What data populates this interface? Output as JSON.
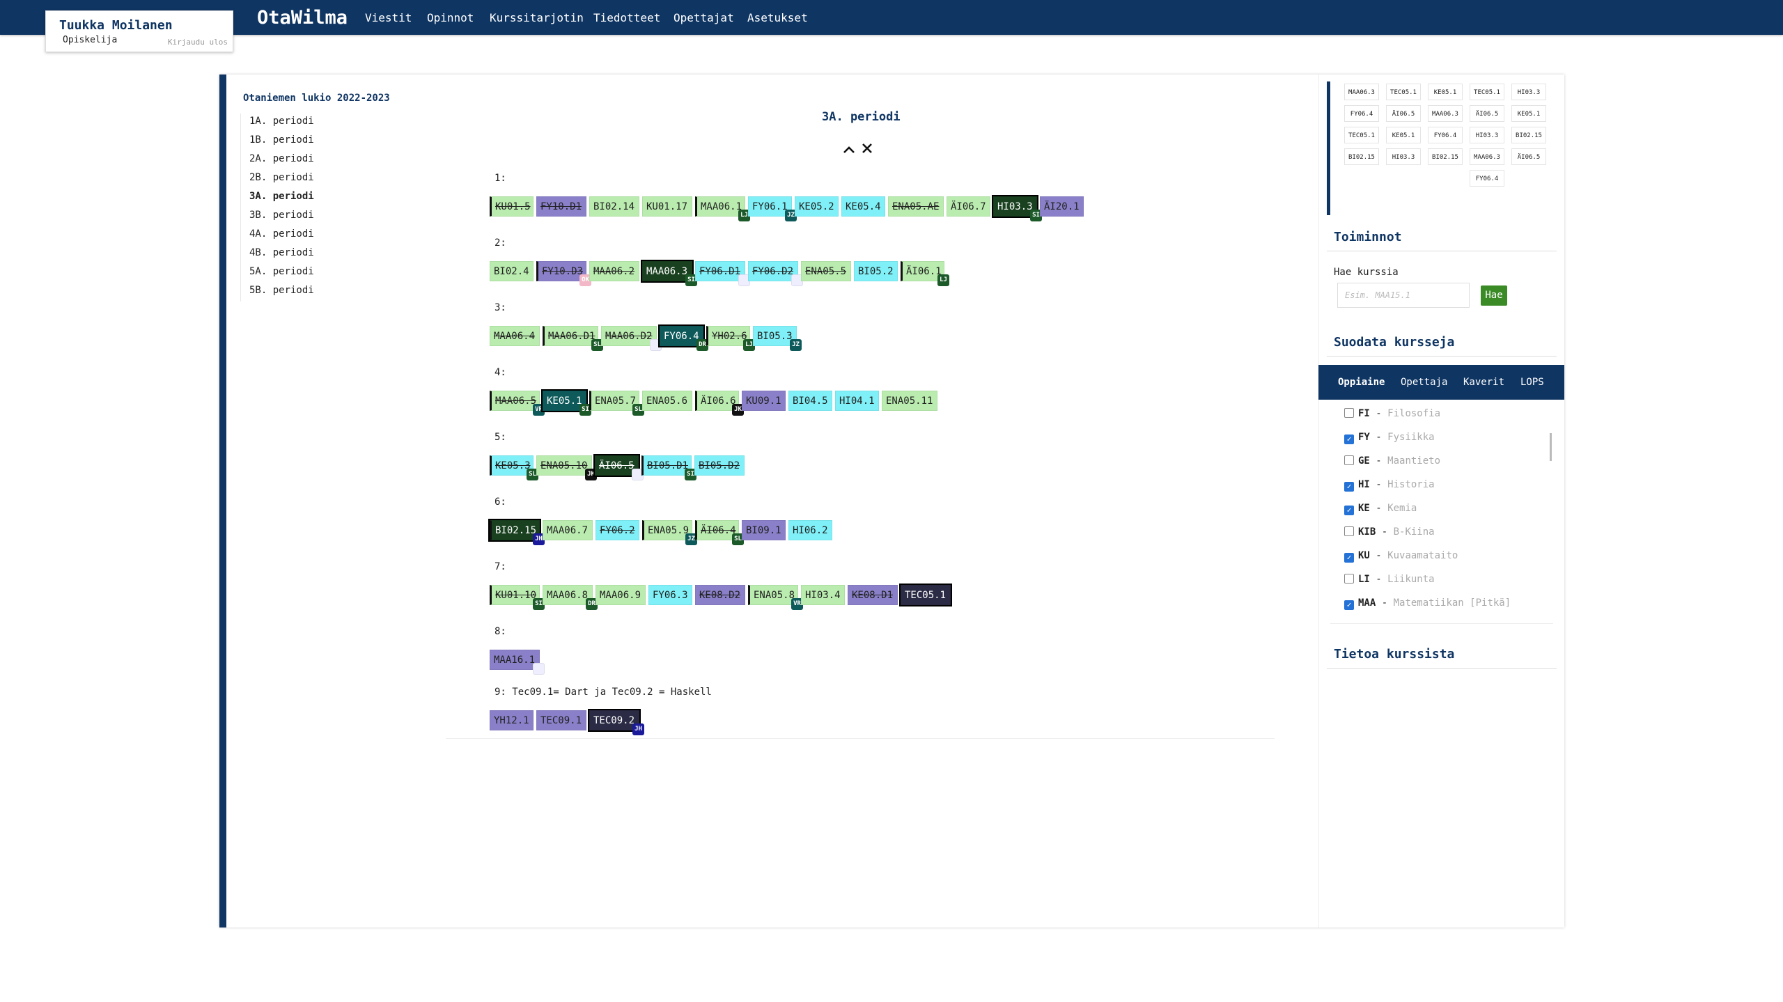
{
  "user": {
    "name": "Tuukka Moilanen",
    "role": "Opiskelija",
    "logout": "Kirjaudu ulos"
  },
  "brand": "OtaWilma",
  "nav": [
    "Viestit",
    "Opinnot",
    "Kurssitarjotin",
    "Tiedotteet",
    "Opettajat",
    "Asetukset"
  ],
  "school_year": "Otaniemen lukio 2022-2023",
  "periods": [
    "1A. periodi",
    "1B. periodi",
    "2A. periodi",
    "2B. periodi",
    "3A. periodi",
    "3B. periodi",
    "4A. periodi",
    "4B. periodi",
    "5A. periodi",
    "5B. periodi"
  ],
  "active_period": "3A. periodi",
  "rows": [
    {
      "label": "1:",
      "courses": [
        {
          "code": "KU01.5",
          "c": "lg",
          "st": 1,
          "sel": 1
        },
        {
          "code": "FY10.D1",
          "c": "pu",
          "st": 1
        },
        {
          "code": "BI02.14",
          "c": "lg"
        },
        {
          "code": "KU01.17",
          "c": "lg"
        },
        {
          "code": "MAA06.1",
          "c": "lg",
          "bd": "LJ",
          "bc": "#1c5a2a",
          "sel": 1
        },
        {
          "code": "FY06.1",
          "c": "cy",
          "bd": "JZ",
          "bc": "#0e5a5b"
        },
        {
          "code": "KE05.2",
          "c": "cy"
        },
        {
          "code": "KE05.4",
          "c": "cy"
        },
        {
          "code": "ENA05.AE",
          "c": "lg",
          "st": 1
        },
        {
          "code": "ÄI06.7",
          "c": "lg"
        },
        {
          "code": "HI03.3",
          "c": "dg",
          "bd": "SI",
          "bc": "#1c5a2a"
        },
        {
          "code": "ÄI20.1",
          "c": "pu"
        }
      ]
    },
    {
      "label": "2:",
      "courses": [
        {
          "code": "BI02.4",
          "c": "lg"
        },
        {
          "code": "FY10.D3",
          "c": "pu",
          "st": 1,
          "bd": "OK",
          "bc": "#f3b8c8",
          "sel": 1
        },
        {
          "code": "MAA06.2",
          "c": "lg",
          "st": 1
        },
        {
          "code": "MAA06.3",
          "c": "dg",
          "bd": "SI",
          "bc": "#1c5a2a"
        },
        {
          "code": "FY06.D1",
          "c": "cy",
          "st": 1,
          "bd": "",
          "bc": ""
        },
        {
          "code": "FY06.D2",
          "c": "cy",
          "st": 1,
          "bd": "",
          "bc": ""
        },
        {
          "code": "ENA05.5",
          "c": "lg",
          "st": 1
        },
        {
          "code": "BI05.2",
          "c": "cy"
        },
        {
          "code": "ÄI06.1",
          "c": "lg",
          "bd": "LJ",
          "bc": "#1c5a2a",
          "sel": 1
        }
      ]
    },
    {
      "label": "3:",
      "courses": [
        {
          "code": "MAA06.4",
          "c": "lg",
          "st": 1
        },
        {
          "code": "MAA06.D1",
          "c": "lg",
          "st": 1,
          "bd": "SL",
          "bc": "#1c5a2a",
          "sel": 1
        },
        {
          "code": "MAA06.D2",
          "c": "lg",
          "st": 1,
          "bd": "",
          "bc": ""
        },
        {
          "code": "FY06.4",
          "c": "tl",
          "bd": "DR",
          "bc": "#1c5a2a"
        },
        {
          "code": "YH02.6",
          "c": "lg",
          "st": 1,
          "bd": "LJ",
          "bc": "#1c5a2a",
          "sel": 1
        },
        {
          "code": "BI05.3",
          "c": "cy",
          "bd": "JZ",
          "bc": "#0e5a5b"
        }
      ]
    },
    {
      "label": "4:",
      "courses": [
        {
          "code": "MAA06.5",
          "c": "lg",
          "st": 1,
          "bd": "VR",
          "bc": "#0e5a5b",
          "sel": 1
        },
        {
          "code": "KE05.1",
          "c": "tl",
          "bd": "SI",
          "bc": "#1c5a2a"
        },
        {
          "code": "ENA05.7",
          "c": "lg",
          "bd": "SL",
          "bc": "#1c5a2a",
          "sel": 1
        },
        {
          "code": "ENA05.6",
          "c": "lg"
        },
        {
          "code": "ÄI06.6",
          "c": "lg",
          "bd": "JK",
          "bc": "#111",
          "sel": 1
        },
        {
          "code": "KU09.1",
          "c": "pu"
        },
        {
          "code": "BI04.5",
          "c": "cy"
        },
        {
          "code": "HI04.1",
          "c": "cy"
        },
        {
          "code": "ENA05.11",
          "c": "lg"
        }
      ]
    },
    {
      "label": "5:",
      "courses": [
        {
          "code": "KE05.3",
          "c": "cy",
          "st": 1,
          "bd": "SL",
          "bc": "#1c5a2a",
          "sel": 1
        },
        {
          "code": "ENA05.10",
          "c": "lg",
          "st": 1,
          "bd": "JK",
          "bc": "#111"
        },
        {
          "code": "ÄI06.5",
          "c": "dg",
          "st": 1,
          "bd": "",
          "bc": ""
        },
        {
          "code": "BI05.D1",
          "c": "cy",
          "st": 1,
          "bd": "SI",
          "bc": "#1c5a2a",
          "sel": 1
        },
        {
          "code": "BI05.D2",
          "c": "cy",
          "st": 1
        }
      ]
    },
    {
      "label": "6:",
      "courses": [
        {
          "code": "BI02.15",
          "c": "dg",
          "bd": "JH",
          "bc": "#1a1a9a",
          "sel": 1
        },
        {
          "code": "MAA06.7",
          "c": "lg"
        },
        {
          "code": "FY06.2",
          "c": "cy",
          "st": 1
        },
        {
          "code": "ENA05.9",
          "c": "lg",
          "bd": "JZ",
          "bc": "#0e5a5b",
          "sel": 1
        },
        {
          "code": "ÄI06.4",
          "c": "lg",
          "st": 1,
          "bd": "SL",
          "bc": "#1c5a2a",
          "sel": 1
        },
        {
          "code": "BI09.1",
          "c": "pu"
        },
        {
          "code": "HI06.2",
          "c": "cy"
        }
      ]
    },
    {
      "label": "7:",
      "courses": [
        {
          "code": "KU01.10",
          "c": "lg",
          "st": 1,
          "bd": "SI",
          "bc": "#1c5a2a",
          "sel": 1
        },
        {
          "code": "MAA06.8",
          "c": "lg",
          "bd": "DR",
          "bc": "#1c5a2a"
        },
        {
          "code": "MAA06.9",
          "c": "lg"
        },
        {
          "code": "FY06.3",
          "c": "cy"
        },
        {
          "code": "KE08.D2",
          "c": "pu",
          "st": 1
        },
        {
          "code": "ENA05.8",
          "c": "lg",
          "bd": "VR",
          "bc": "#0e5a5b",
          "sel": 1
        },
        {
          "code": "HI03.4",
          "c": "lg"
        },
        {
          "code": "KE08.D1",
          "c": "pu",
          "st": 1
        },
        {
          "code": "TEC05.1",
          "c": "dk"
        }
      ]
    },
    {
      "label": "8:",
      "courses": [
        {
          "code": "MAA16.1",
          "c": "pu",
          "bd": "",
          "bc": ""
        }
      ]
    },
    {
      "label": "9: Tec09.1= Dart ja Tec09.2 = Haskell",
      "courses": [
        {
          "code": "YH12.1",
          "c": "pu"
        },
        {
          "code": "TEC09.1",
          "c": "pu"
        },
        {
          "code": "TEC09.2",
          "c": "dk",
          "bd": "JH",
          "bc": "#1a1a9a"
        }
      ]
    }
  ],
  "timetable": [
    [
      "MAA06.3",
      "TEC05.1",
      "KE05.1",
      "TEC05.1",
      "HI03.3"
    ],
    [
      "FY06.4",
      "ÄI06.5",
      "MAA06.3",
      "ÄI06.5",
      "KE05.1"
    ],
    [
      "TEC05.1",
      "KE05.1",
      "FY06.4",
      "HI03.3",
      "BI02.15"
    ],
    [
      "BI02.15",
      "HI03.3",
      "BI02.15",
      "MAA06.3",
      "ÄI06.5"
    ],
    [
      "",
      "",
      "",
      "FY06.4",
      ""
    ]
  ],
  "toiminnot": "Toiminnot",
  "search": {
    "label": "Hae kurssia",
    "placeholder": "Esim. MAA15.1",
    "button": "Hae"
  },
  "suodata": "Suodata kursseja",
  "filter_tabs": [
    "Oppiaine",
    "Opettaja",
    "Kaverit",
    "LOPS"
  ],
  "subjects": [
    {
      "code": "FI",
      "name": "Filosofia",
      "checked": false
    },
    {
      "code": "FY",
      "name": "Fysiikka",
      "checked": true
    },
    {
      "code": "GE",
      "name": "Maantieto",
      "checked": false
    },
    {
      "code": "HI",
      "name": "Historia",
      "checked": true
    },
    {
      "code": "KE",
      "name": "Kemia",
      "checked": true
    },
    {
      "code": "KIB",
      "name": "B-Kiina",
      "checked": false
    },
    {
      "code": "KU",
      "name": "Kuvaamataito",
      "checked": true
    },
    {
      "code": "LI",
      "name": "Liikunta",
      "checked": false
    },
    {
      "code": "MAA",
      "name": "Matematiikan [Pitkä]",
      "checked": true
    }
  ],
  "tietoa": "Tietoa kurssista",
  "colors": {
    "brand": "#0f3563",
    "light_green": "#b9ecae",
    "cyan": "#7ff0f7",
    "purple": "#8a80c9",
    "dark_green": "#19401f",
    "teal": "#0e5a5b",
    "dark": "#2b2b45",
    "button_green": "#3a8b26"
  },
  "icons": {
    "up": "chevron-up-icon",
    "close": "close-icon"
  }
}
